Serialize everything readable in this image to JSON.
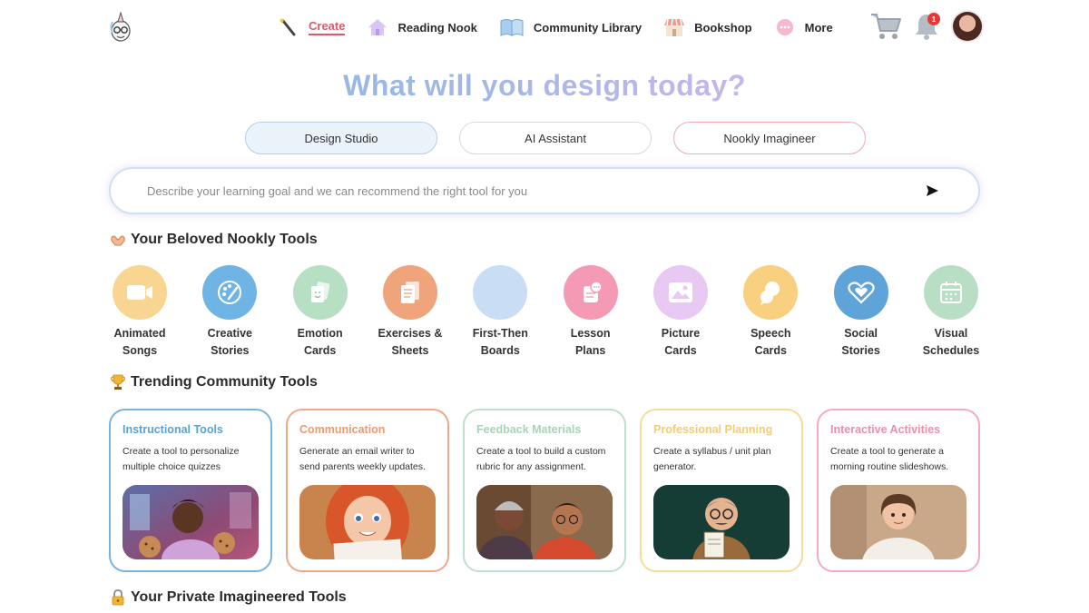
{
  "nav": {
    "items": [
      {
        "label": "Create",
        "icon": "magic-wand-icon",
        "active": true
      },
      {
        "label": "Reading Nook",
        "icon": "house-icon"
      },
      {
        "label": "Community Library",
        "icon": "book-icon"
      },
      {
        "label": "Bookshop",
        "icon": "shop-icon"
      },
      {
        "label": "More",
        "icon": "more-dots-icon"
      }
    ],
    "notification_count": "1"
  },
  "headline": "What will you design today?",
  "tabs": [
    {
      "label": "Design Studio"
    },
    {
      "label": "AI Assistant"
    },
    {
      "label": "Nookly Imagineer"
    }
  ],
  "prompt": {
    "placeholder": "Describe your learning goal and we can recommend the right tool for you"
  },
  "sections": {
    "beloved": "Your Beloved Nookly Tools",
    "trending": "Trending Community Tools",
    "private": "Your Private Imagineered Tools"
  },
  "tools": [
    {
      "label": "Animated\nSongs",
      "icon": "video-camera-icon",
      "color": "#f9d592"
    },
    {
      "label": "Creative\nStories",
      "icon": "palette-icon",
      "color": "#6fb4e4"
    },
    {
      "label": "Emotion\nCards",
      "icon": "emotion-card-icon",
      "color": "#b7dfc4"
    },
    {
      "label": "Exercises &\nSheets",
      "icon": "worksheet-icon",
      "color": "#f0a47c"
    },
    {
      "label": "First-Then\nBoards",
      "icon": "board-icon",
      "color": "#c9def4"
    },
    {
      "label": "Lesson\nPlans",
      "icon": "lesson-icon",
      "color": "#f59ab4"
    },
    {
      "label": "Picture\nCards",
      "icon": "picture-icon",
      "color": "#e8c9f3"
    },
    {
      "label": "Speech\nCards",
      "icon": "speech-bubble-icon",
      "color": "#f9d080"
    },
    {
      "label": "Social\nStories",
      "icon": "heart-hands-icon",
      "color": "#5fa4d9"
    },
    {
      "label": "Visual\nSchedules",
      "icon": "calendar-icon",
      "color": "#b8dfc6"
    }
  ],
  "cards": [
    {
      "title": "Instructional Tools",
      "desc": "Create a tool to personalize multiple choice quizzes",
      "color": "#7ab3dd",
      "title_color": "#5aa1d6"
    },
    {
      "title": "Communication",
      "desc": "Generate an email writer to send parents weekly updates.",
      "color": "#f0a886",
      "title_color": "#eb9a72"
    },
    {
      "title": "Feedback Materials",
      "desc": "Create a tool to build a custom rubric for any assignment.",
      "color": "#bfe0cc",
      "title_color": "#a9d3b8"
    },
    {
      "title": "Professional Planning",
      "desc": "Create a syllabus / unit plan generator.",
      "color": "#f7dc98",
      "title_color": "#f3cc77"
    },
    {
      "title": "Interactive Activities",
      "desc": "Create a tool to generate a morning routine slideshows.",
      "color": "#f2abc0",
      "title_color": "#ec8faa"
    }
  ]
}
